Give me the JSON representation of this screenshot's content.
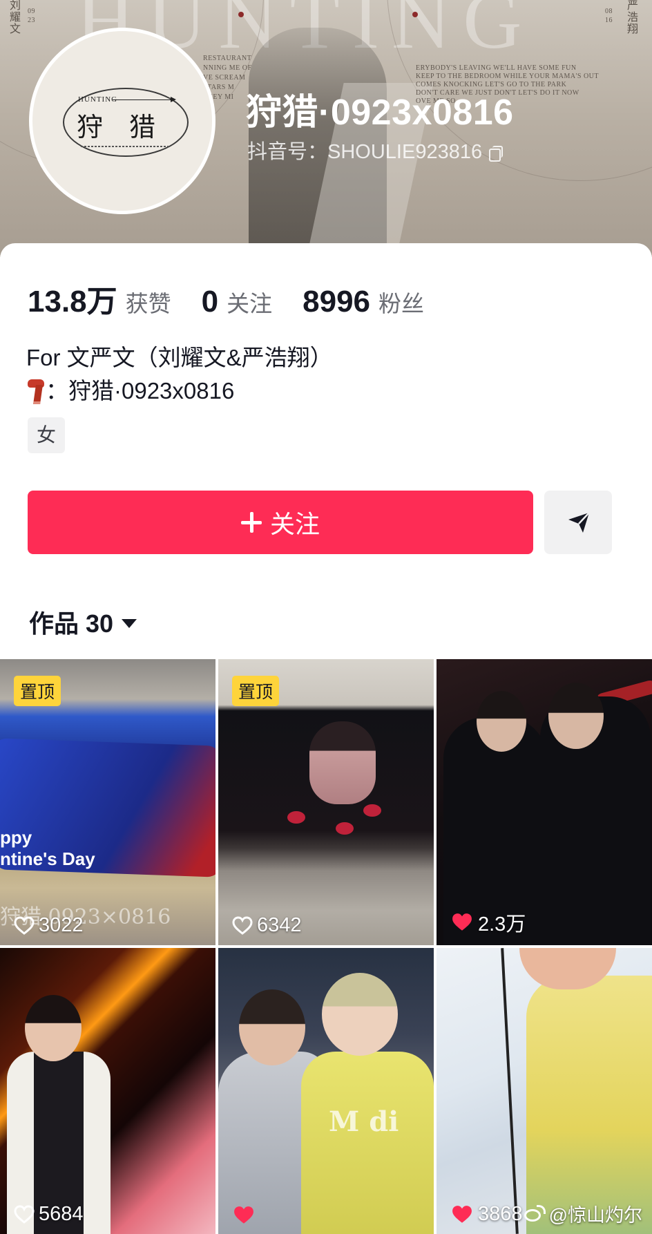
{
  "profile": {
    "name": "狩猎·0923x0816",
    "douyin_id": "抖音号：SHOULIE923816",
    "avatar": {
      "hunting_text": "HUNTING",
      "char_left": "狩",
      "char_right": "猎"
    },
    "banner": {
      "left_name": "刘耀文",
      "left_date": "09 23",
      "right_name": "严浩翔",
      "right_date": "08 16",
      "lyrics_left": [
        "RESTAURANT",
        "NNING ME OF",
        "VE SCREAM",
        "STARS M",
        "THEY MI"
      ],
      "lyrics_right": [
        "ERYBODY'S LEAVING WE'LL HAVE SOME FUN",
        "KEEP TO THE BEDROOM WHILE YOUR MAMA'S OUT",
        "COMES KNOCKING LET'S GO TO THE PARK",
        "DON'T CARE WE JUST DON'T LET'S DO IT NOW",
        "OVE ME SO"
      ]
    }
  },
  "stats": [
    {
      "value": "13.8万",
      "label": "获赞"
    },
    {
      "value": "0",
      "label": "关注"
    },
    {
      "value": "8996",
      "label": "粉丝"
    }
  ],
  "bio": {
    "line1": "For 文严文（刘耀文&严浩翔）",
    "line2": "：狩猎·0923x0816",
    "tag": "女"
  },
  "actions": {
    "follow_label": "关注"
  },
  "works": {
    "label": "作品 30"
  },
  "grid": [
    {
      "pinned_label": "置顶",
      "likes": "3022",
      "liked": false,
      "screen_text": "ppy\nntine's Day",
      "overlay": "狩猎  0923×0816"
    },
    {
      "pinned_label": "置顶",
      "likes": "6342",
      "liked": false
    },
    {
      "pinned_label": "",
      "likes": "2.3万",
      "liked": true
    },
    {
      "pinned_label": "",
      "likes": "5684",
      "liked": false
    },
    {
      "pinned_label": "",
      "likes": "",
      "liked": true,
      "jersey_text": "M di"
    },
    {
      "pinned_label": "",
      "likes": "3868",
      "liked": true
    }
  ],
  "watermark": "@惊山灼尔",
  "colors": {
    "accent": "#fe2c55",
    "pin": "#fed43b",
    "text_primary": "#161823",
    "text_secondary": "#6b6d74"
  }
}
